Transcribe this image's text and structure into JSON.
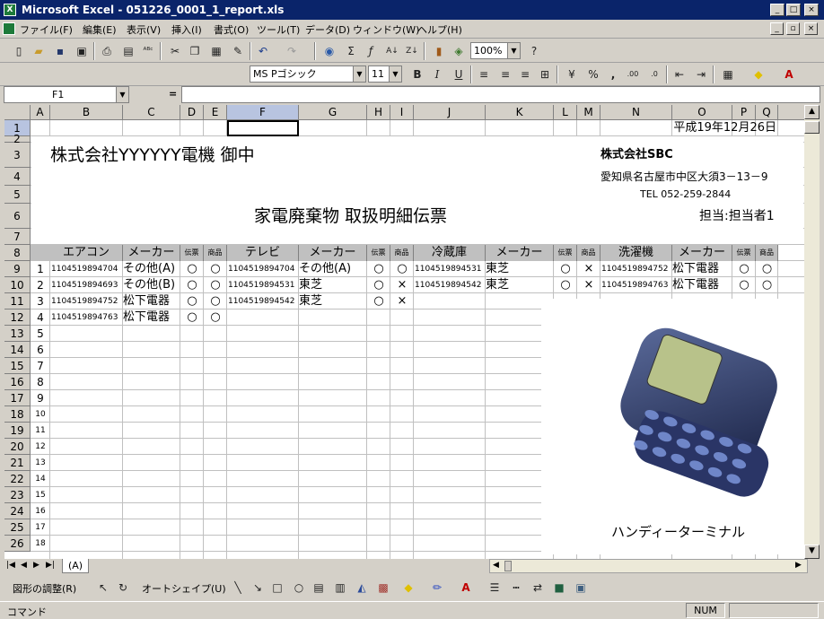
{
  "window": {
    "title": "Microsoft Excel - 051226_0001_1_report.xls"
  },
  "menu": [
    "ファイル(F)",
    "編集(E)",
    "表示(V)",
    "挿入(I)",
    "書式(O)",
    "ツール(T)",
    "データ(D)",
    "ウィンドウ(W)",
    "ヘルプ(H)"
  ],
  "toolbar": {
    "zoom": "100%"
  },
  "format": {
    "font": "MS Pゴシック",
    "size": "11"
  },
  "formula": {
    "namebox": "F1",
    "equals": "=",
    "content": ""
  },
  "columns": [
    "A",
    "B",
    "C",
    "D",
    "E",
    "F",
    "G",
    "H",
    "I",
    "J",
    "K",
    "L",
    "M",
    "N",
    "O",
    "P",
    "Q",
    "R"
  ],
  "rows": [
    "1",
    "2",
    "3",
    "4",
    "5",
    "6",
    "7",
    "8",
    "9",
    "10",
    "11",
    "12",
    "13",
    "14",
    "15",
    "16",
    "17",
    "18",
    "19",
    "20",
    "21",
    "22",
    "23",
    "24",
    "25",
    "26"
  ],
  "sheet": {
    "date": "平成19年12月26日",
    "recipient": "株式会社YYYYYY電機  御中",
    "company": "株式会社SBC",
    "address": "愛知県名古屋市中区大須3－13－9",
    "tel": "TEL  052-259-2844",
    "doc_title": "家電廃棄物  取扱明細伝票",
    "person": "担当:担当者1",
    "headers": [
      "エアコン",
      "メーカー",
      "伝票",
      "商品",
      "テレビ",
      "メーカー",
      "伝票",
      "商品",
      "冷蔵庫",
      "メーカー",
      "伝票",
      "商品",
      "洗濯機",
      "メーカー",
      "伝票",
      "商品"
    ],
    "row_numbers": [
      "1",
      "2",
      "3",
      "4",
      "5",
      "6",
      "7",
      "8",
      "9",
      "10",
      "11",
      "12",
      "13",
      "14",
      "15",
      "16",
      "17",
      "18"
    ],
    "records": [
      [
        "1104519894704",
        "その他(A)",
        "○",
        "○",
        "1104519894704",
        "その他(A)",
        "○",
        "○",
        "1104519894531",
        "東芝",
        "○",
        "×",
        "1104519894752",
        "松下電器",
        "○",
        "○"
      ],
      [
        "1104519894693",
        "その他(B)",
        "○",
        "○",
        "1104519894531",
        "東芝",
        "○",
        "×",
        "1104519894542",
        "東芝",
        "○",
        "×",
        "1104519894763",
        "松下電器",
        "○",
        "○"
      ],
      [
        "1104519894752",
        "松下電器",
        "○",
        "○",
        "1104519894542",
        "東芝",
        "○",
        "×",
        "",
        "",
        "",
        "",
        "",
        "",
        "",
        ""
      ],
      [
        "1104519894763",
        "松下電器",
        "○",
        "○",
        "",
        "",
        "",
        "",
        "",
        "",
        "",
        "",
        "",
        "",
        "",
        ""
      ]
    ],
    "image_caption": "ハンディーターミナル"
  },
  "tabs": [
    "(A)"
  ],
  "drawbar": {
    "adjust": "図形の調整(R)",
    "autoshape": "オートシェイプ(U)"
  },
  "status": {
    "left": "コマンド",
    "num": "NUM"
  }
}
